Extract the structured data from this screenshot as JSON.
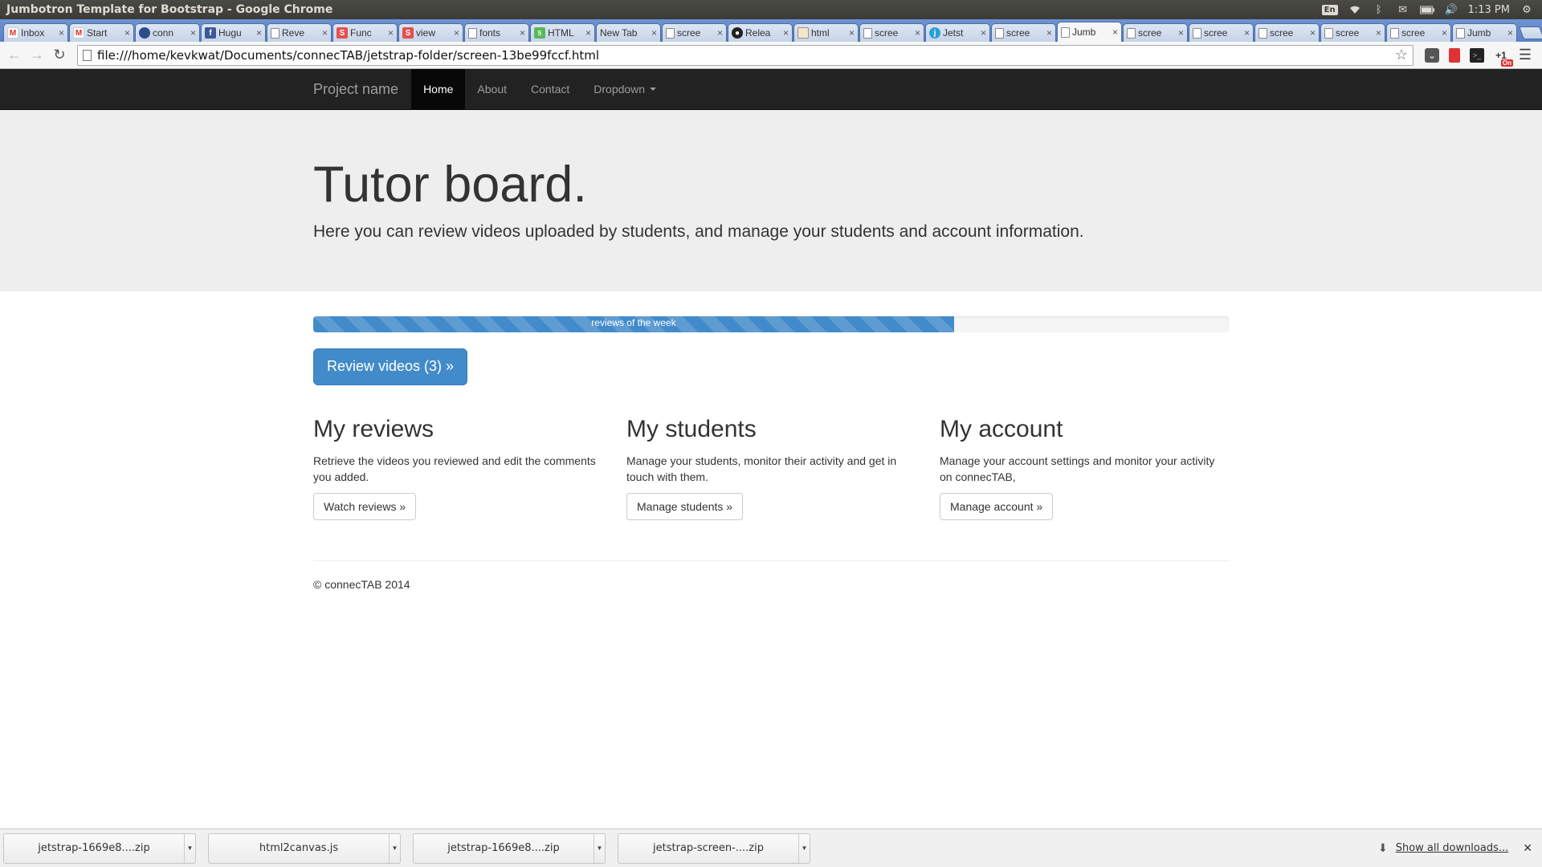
{
  "os": {
    "window_title": "Jumbotron Template for Bootstrap - Google Chrome",
    "lang": "En",
    "time": "1:13 PM"
  },
  "tabs": [
    {
      "title": "Inbox",
      "icon": "gmail-icon"
    },
    {
      "title": "Start",
      "icon": "gmail-icon"
    },
    {
      "title": "conn",
      "icon": "circle-icon"
    },
    {
      "title": "Hugu",
      "icon": "facebook-icon"
    },
    {
      "title": "Reve",
      "icon": "page-icon"
    },
    {
      "title": "Func",
      "icon": "s-icon"
    },
    {
      "title": "view",
      "icon": "s-icon"
    },
    {
      "title": "fonts",
      "icon": "page-icon"
    },
    {
      "title": "HTML",
      "icon": "html5-icon"
    },
    {
      "title": "New Tab",
      "icon": "none"
    },
    {
      "title": "scree",
      "icon": "page-icon"
    },
    {
      "title": "Relea",
      "icon": "github-icon"
    },
    {
      "title": "html",
      "icon": "doc-icon"
    },
    {
      "title": "scree",
      "icon": "page-icon"
    },
    {
      "title": "Jetst",
      "icon": "jetstrap-icon"
    },
    {
      "title": "scree",
      "icon": "page-icon"
    },
    {
      "title": "Jumb",
      "icon": "page-icon",
      "active": true
    },
    {
      "title": "scree",
      "icon": "page-icon"
    },
    {
      "title": "scree",
      "icon": "page-icon"
    },
    {
      "title": "scree",
      "icon": "page-icon"
    },
    {
      "title": "scree",
      "icon": "page-icon"
    },
    {
      "title": "scree",
      "icon": "page-icon"
    },
    {
      "title": "Jumb",
      "icon": "page-icon"
    }
  ],
  "toolbar": {
    "url": "file:///home/kevkwat/Documents/connecTAB/jetstrap-folder/screen-13be99fccf.html"
  },
  "navbar": {
    "brand": "Project name",
    "items": [
      {
        "label": "Home"
      },
      {
        "label": "About"
      },
      {
        "label": "Contact"
      },
      {
        "label": "Dropdown"
      }
    ]
  },
  "jumbotron": {
    "title": "Tutor board.",
    "lead": "Here you can review videos uploaded by students, and manage your students and account information."
  },
  "progress": {
    "label": "reviews of the week",
    "percent": 70
  },
  "review_button": "Review videos (3) »",
  "columns": [
    {
      "heading": "My reviews",
      "text": "Retrieve the videos you reviewed and edit the comments you added.",
      "button": "Watch reviews »"
    },
    {
      "heading": "My students",
      "text": "Manage your students, monitor their activity and get in touch with them.",
      "button": "Manage students »"
    },
    {
      "heading": "My account",
      "text": "Manage your account settings and monitor your activity on connecTAB,",
      "button": "Manage account »"
    }
  ],
  "footer": "© connecTAB 2014",
  "downloads": {
    "items": [
      {
        "name": "jetstrap-1669e8....zip"
      },
      {
        "name": "html2canvas.js"
      },
      {
        "name": "jetstrap-1669e8....zip"
      },
      {
        "name": "jetstrap-screen-....zip"
      }
    ],
    "show_all": "Show all downloads..."
  },
  "colors": {
    "navbar_bg": "#222222",
    "jumbotron_bg": "#eeeeee",
    "primary": "#428bca",
    "tabstrip": "#5d85c8"
  }
}
